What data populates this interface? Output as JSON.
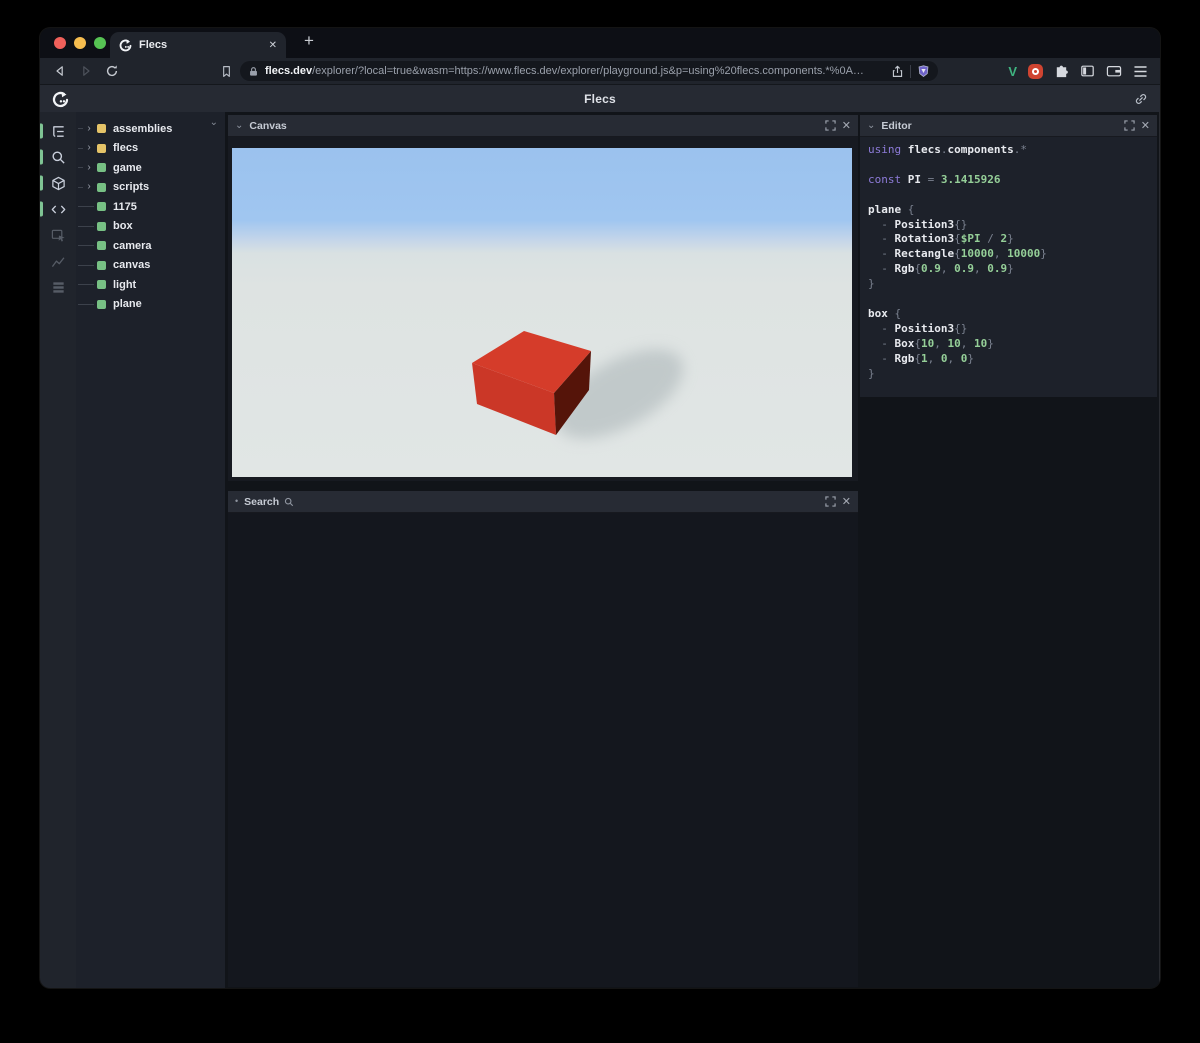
{
  "icons": {
    "close_glyph": "✕",
    "plus_glyph": "+",
    "chevron_down": "⌄",
    "chevron_right": "›",
    "bullet": "•"
  },
  "browser": {
    "tab_title": "Flecs",
    "url_host": "flecs.dev",
    "url_path": "/explorer/?local=true&wasm=https://www.flecs.dev/explorer/playground.js&p=using%20flecs.components.*%0A…",
    "extension_v_label": "V"
  },
  "app": {
    "title": "Flecs",
    "colors": {
      "active_accent": "#7fc494",
      "module_yellow": "#e4c368",
      "entity_green": "#77c084",
      "code_keyword": "#8d7bd8",
      "code_number": "#95cf98",
      "header_bg": "#262a33"
    },
    "sidebar": {
      "icons": [
        {
          "name": "entity-tree",
          "active": true
        },
        {
          "name": "query-search",
          "active": true
        },
        {
          "name": "canvas-3d",
          "active": true
        },
        {
          "name": "code-editor",
          "active": true
        },
        {
          "name": "inspector",
          "active": false
        },
        {
          "name": "statistics",
          "active": false
        },
        {
          "name": "tables",
          "active": false
        }
      ]
    },
    "tree": {
      "items": [
        {
          "label": "assemblies",
          "color": "#e4c368",
          "expandable": true
        },
        {
          "label": "flecs",
          "color": "#e4c368",
          "expandable": true
        },
        {
          "label": "game",
          "color": "#77c084",
          "expandable": true
        },
        {
          "label": "scripts",
          "color": "#77c084",
          "expandable": true
        },
        {
          "label": "1175",
          "color": "#77c084",
          "expandable": false
        },
        {
          "label": "box",
          "color": "#77c084",
          "expandable": false
        },
        {
          "label": "camera",
          "color": "#77c084",
          "expandable": false
        },
        {
          "label": "canvas",
          "color": "#77c084",
          "expandable": false
        },
        {
          "label": "light",
          "color": "#77c084",
          "expandable": false
        },
        {
          "label": "plane",
          "color": "#77c084",
          "expandable": false
        }
      ]
    },
    "panels": {
      "canvas": {
        "title": "Canvas"
      },
      "search": {
        "title": "Search"
      },
      "editor": {
        "title": "Editor"
      }
    },
    "scene": {
      "sky_top": "#9bc2ee",
      "sky_low": "#a0c6f0",
      "horizon": "#d9e1e2",
      "ground": "#e1e6e5",
      "ground_top": "#dee3e2",
      "box_top": "#d53c2a",
      "box_left": "#cb3727",
      "box_right": "#551409",
      "shadow": "#a9b3b6"
    },
    "editor": {
      "lines": [
        [
          [
            "kw",
            "using"
          ],
          [
            "pu",
            " "
          ],
          [
            "id",
            "flecs"
          ],
          [
            "pu",
            "."
          ],
          [
            "id",
            "components"
          ],
          [
            "pu",
            "."
          ],
          [
            "pu",
            "*"
          ]
        ],
        [],
        [
          [
            "kw",
            "const"
          ],
          [
            "pu",
            " "
          ],
          [
            "id",
            "PI"
          ],
          [
            "pu",
            " = "
          ],
          [
            "num",
            "3.1415926"
          ]
        ],
        [],
        [
          [
            "id",
            "plane"
          ],
          [
            "pu",
            " {"
          ]
        ],
        [
          [
            "pu",
            "  - "
          ],
          [
            "id",
            "Position3"
          ],
          [
            "pu",
            "{}"
          ]
        ],
        [
          [
            "pu",
            "  - "
          ],
          [
            "id",
            "Rotation3"
          ],
          [
            "pu",
            "{"
          ],
          [
            "num",
            "$PI"
          ],
          [
            "pu",
            " / "
          ],
          [
            "num",
            "2"
          ],
          [
            "pu",
            "}"
          ]
        ],
        [
          [
            "pu",
            "  - "
          ],
          [
            "id",
            "Rectangle"
          ],
          [
            "pu",
            "{"
          ],
          [
            "num",
            "10000"
          ],
          [
            "pu",
            ", "
          ],
          [
            "num",
            "10000"
          ],
          [
            "pu",
            "}"
          ]
        ],
        [
          [
            "pu",
            "  - "
          ],
          [
            "id",
            "Rgb"
          ],
          [
            "pu",
            "{"
          ],
          [
            "num",
            "0.9"
          ],
          [
            "pu",
            ", "
          ],
          [
            "num",
            "0.9"
          ],
          [
            "pu",
            ", "
          ],
          [
            "num",
            "0.9"
          ],
          [
            "pu",
            "}"
          ]
        ],
        [
          [
            "pu",
            "}"
          ]
        ],
        [],
        [
          [
            "id",
            "box"
          ],
          [
            "pu",
            " {"
          ]
        ],
        [
          [
            "pu",
            "  - "
          ],
          [
            "id",
            "Position3"
          ],
          [
            "pu",
            "{}"
          ]
        ],
        [
          [
            "pu",
            "  - "
          ],
          [
            "id",
            "Box"
          ],
          [
            "pu",
            "{"
          ],
          [
            "num",
            "10"
          ],
          [
            "pu",
            ", "
          ],
          [
            "num",
            "10"
          ],
          [
            "pu",
            ", "
          ],
          [
            "num",
            "10"
          ],
          [
            "pu",
            "}"
          ]
        ],
        [
          [
            "pu",
            "  - "
          ],
          [
            "id",
            "Rgb"
          ],
          [
            "pu",
            "{"
          ],
          [
            "num",
            "1"
          ],
          [
            "pu",
            ", "
          ],
          [
            "num",
            "0"
          ],
          [
            "pu",
            ", "
          ],
          [
            "num",
            "0"
          ],
          [
            "pu",
            "}"
          ]
        ],
        [
          [
            "pu",
            "}"
          ]
        ]
      ]
    }
  }
}
